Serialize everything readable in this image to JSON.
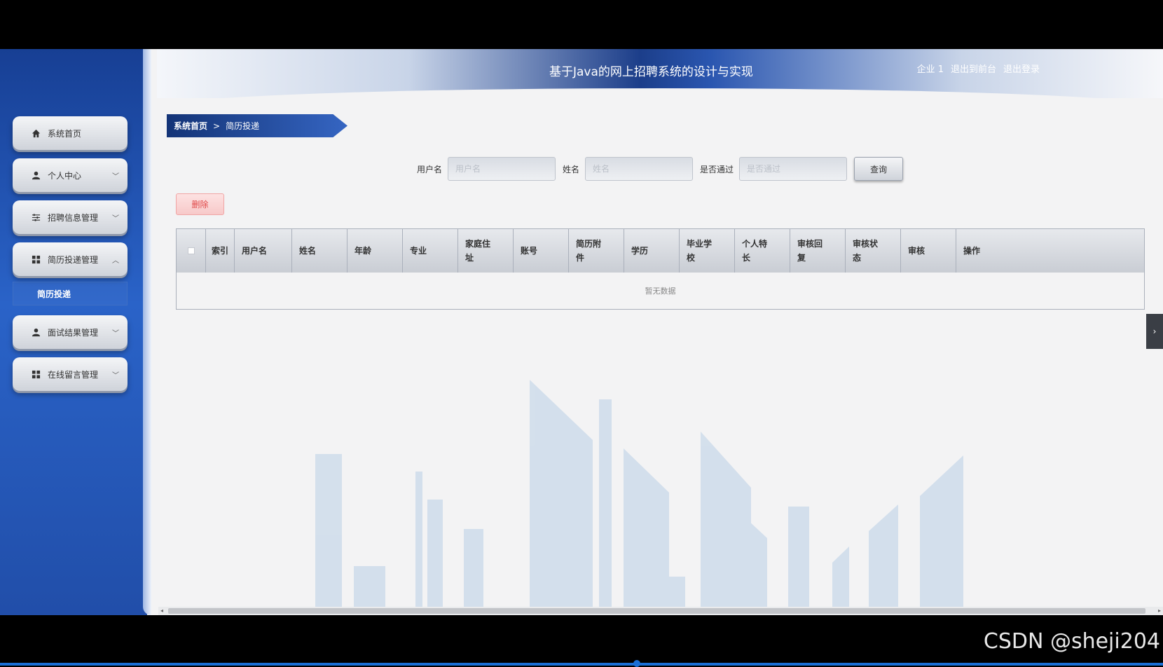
{
  "header": {
    "title": "基于Java的网上招聘系统的设计与实现",
    "user": "企业 1",
    "to_front": "退出到前台",
    "logout": "退出登录"
  },
  "sidebar": {
    "items": [
      {
        "label": "系统首页",
        "icon": "home-icon"
      },
      {
        "label": "个人中心",
        "icon": "user-icon"
      },
      {
        "label": "招聘信息管理",
        "icon": "sliders-icon"
      },
      {
        "label": "简历投递管理",
        "icon": "grid-icon"
      },
      {
        "label": "面试结果管理",
        "icon": "user-icon"
      },
      {
        "label": "在线留言管理",
        "icon": "grid-icon"
      }
    ],
    "active_sub": "简历投递"
  },
  "breadcrumb": {
    "home": "系统首页",
    "separator": ">",
    "current": "简历投递"
  },
  "search": {
    "username_label": "用户名",
    "username_placeholder": "用户名",
    "name_label": "姓名",
    "name_placeholder": "姓名",
    "passed_label": "是否通过",
    "passed_placeholder": "是否通过",
    "query_button": "查询"
  },
  "actions": {
    "delete_button": "删除"
  },
  "table": {
    "columns": [
      "索引",
      "用户名",
      "姓名",
      "年龄",
      "专业",
      "家庭住址",
      "账号",
      "简历附件",
      "学历",
      "毕业学校",
      "个人特长",
      "审核回复",
      "审核状态",
      "审核",
      "操作"
    ],
    "empty_text": "暂无数据"
  },
  "watermark": "CSDN @sheji204",
  "colors": {
    "accent": "#1c3e8a",
    "delete": "#e04848"
  }
}
